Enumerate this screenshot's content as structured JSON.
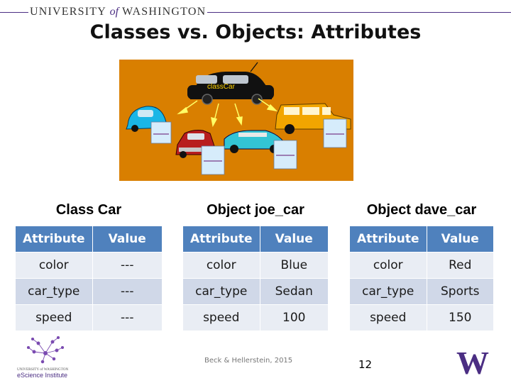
{
  "header": {
    "university_pre": "UNIVERSITY",
    "university_of": "of",
    "university_post": "WASHINGTON",
    "colors": {
      "uw_purple": "#4b2e83"
    }
  },
  "slide": {
    "title": "Classes vs. Objects: Attributes",
    "page_number": "12",
    "credit": "Beck & Hellerstein, 2015"
  },
  "illustration": {
    "class_label": "classCar",
    "background_color": "#d97f00",
    "car_colors": [
      "#1ab6e6",
      "#b81e1e",
      "#33c4d4",
      "#f2a500"
    ]
  },
  "tables": [
    {
      "caption": "Class Car",
      "headers": [
        "Attribute",
        "Value"
      ],
      "rows": [
        [
          "color",
          "---"
        ],
        [
          "car_type",
          "---"
        ],
        [
          "speed",
          "---"
        ]
      ]
    },
    {
      "caption": "Object joe_car",
      "headers": [
        "Attribute",
        "Value"
      ],
      "rows": [
        [
          "color",
          "Blue"
        ],
        [
          "car_type",
          "Sedan"
        ],
        [
          "speed",
          "100"
        ]
      ]
    },
    {
      "caption": "Object dave_car",
      "headers": [
        "Attribute",
        "Value"
      ],
      "rows": [
        [
          "color",
          "Red"
        ],
        [
          "car_type",
          "Sports"
        ],
        [
          "speed",
          "150"
        ]
      ]
    }
  ],
  "footer": {
    "logo_top": "UNIVERSITY of WASHINGTON",
    "logo_name": "eScience Institute",
    "w_logo_letter": "W"
  }
}
